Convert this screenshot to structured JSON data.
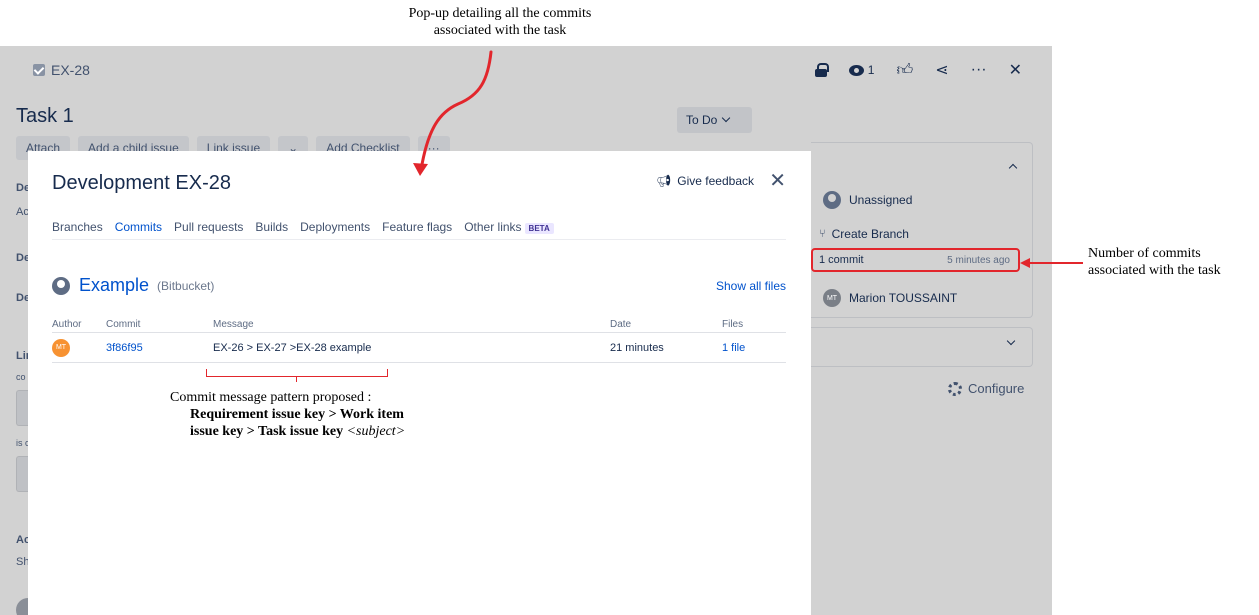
{
  "annotations": {
    "top": [
      "Pop-up detailing all the commits",
      "associated with the task"
    ],
    "right": [
      "Number of commits",
      "associated with the task"
    ],
    "pattern_intro": "Commit message pattern proposed :",
    "pattern_line2": "Requirement issue key > Work item",
    "pattern_line3_bold": "issue key > Task issue key",
    "pattern_line3_italic": " <subject>",
    "accent_color": "#e2262c"
  },
  "issue": {
    "key": "EX-28",
    "watch_count": "1",
    "title": "Task 1",
    "toolbar": [
      "Attach",
      "Add a child issue",
      "Link issue",
      "⌄",
      "Add Checklist",
      "···"
    ],
    "left_fragments": [
      "De",
      "Ac",
      "De",
      "De",
      "Lin",
      "co",
      "is c",
      "Ac",
      "Sh"
    ],
    "status": "To Do",
    "assignee": "Unassigned",
    "create_branch": "Create Branch",
    "commit_count": "1 commit",
    "commit_time": "5 minutes ago",
    "reporter_initials": "MT",
    "reporter": "Marion TOUSSAINT",
    "configure": "Configure"
  },
  "modal": {
    "title": "Development EX-28",
    "feedback": "Give feedback",
    "close": "✕",
    "tabs": [
      "Branches",
      "Commits",
      "Pull requests",
      "Builds",
      "Deployments",
      "Feature flags",
      "Other links"
    ],
    "active_tab": "Commits",
    "beta": "BETA",
    "repo": "Example",
    "repo_source": "(Bitbucket)",
    "show_all": "Show all files",
    "columns": [
      "Author",
      "Commit",
      "Message",
      "Date",
      "Files"
    ],
    "rows": [
      {
        "initials": "MT",
        "commit": "3f86f95",
        "message": "EX-26 > EX-27 >EX-28 example",
        "date": "21 minutes",
        "files": "1 file"
      }
    ]
  }
}
